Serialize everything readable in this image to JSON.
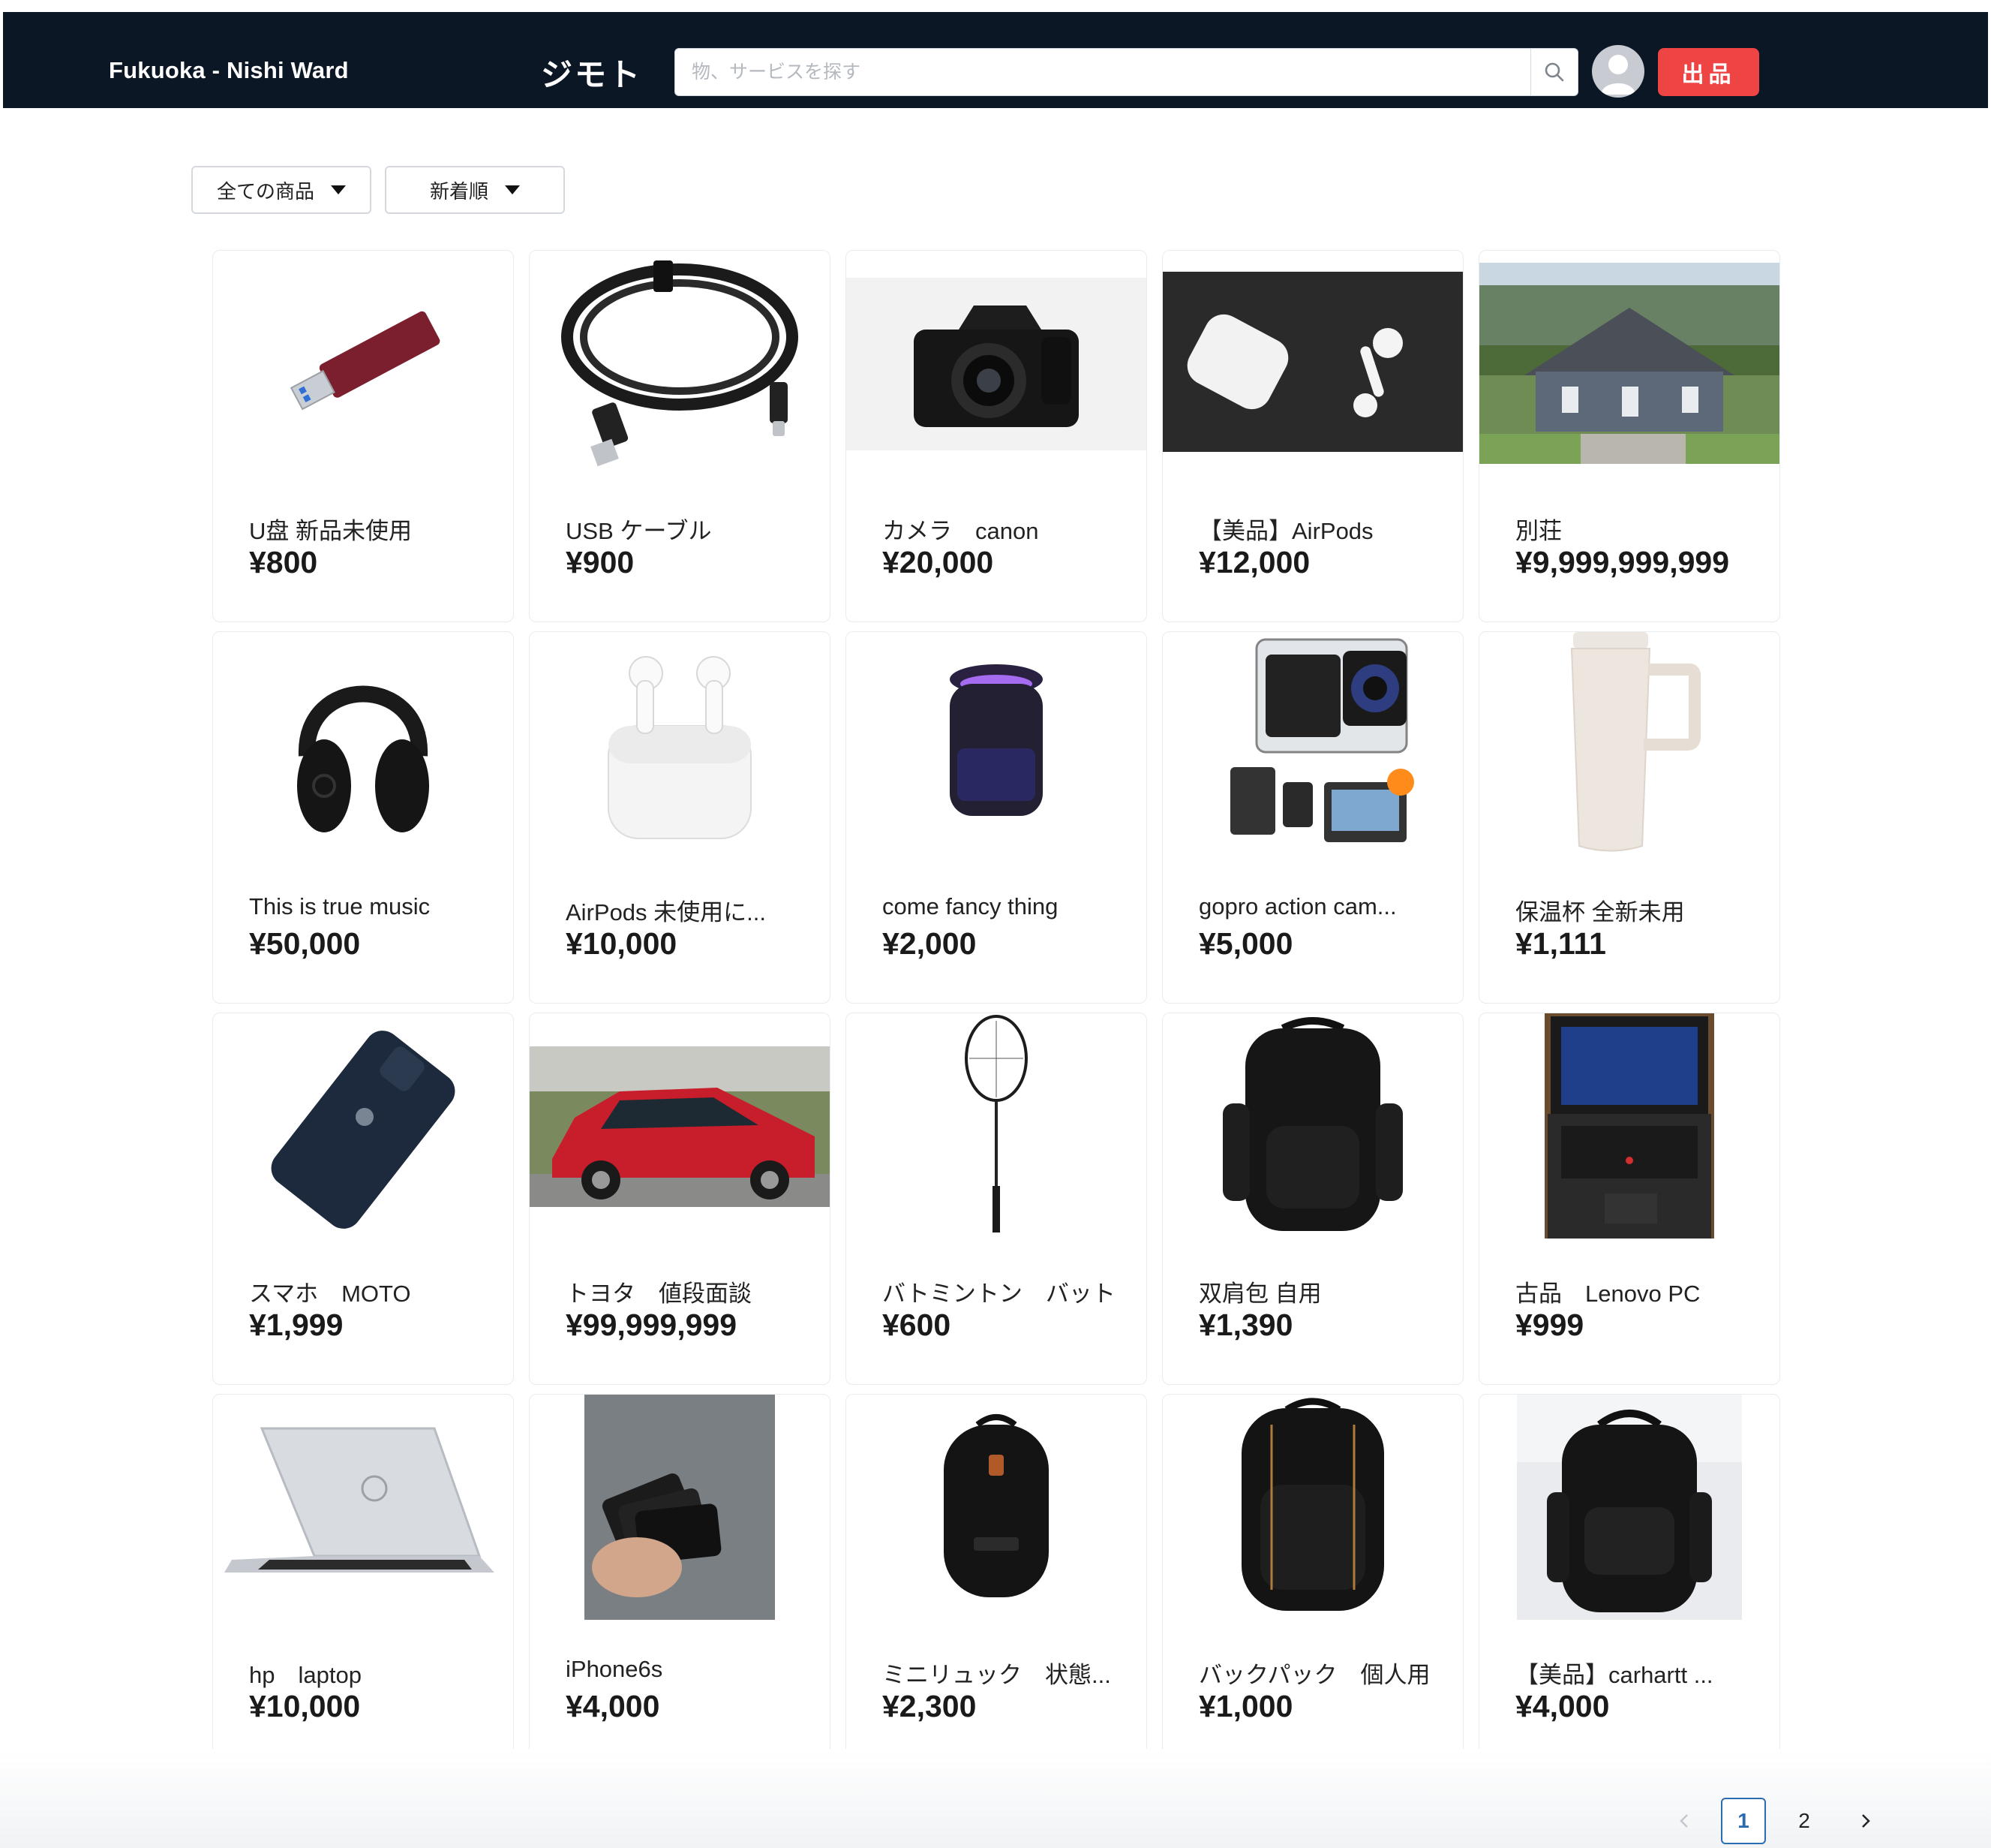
{
  "header": {
    "location": "Fukuoka - Nishi Ward",
    "brand": "ジモト",
    "search_placeholder": "物、サービスを探す",
    "post_label": "出品"
  },
  "filters": {
    "category": "全ての商品",
    "sort": "新着順"
  },
  "products": [
    {
      "title": "U盘 新品未使用",
      "price": "¥800",
      "icon": "usb-drive-icon"
    },
    {
      "title": "USB ケーブル",
      "price": "¥900",
      "icon": "usb-cable-icon"
    },
    {
      "title": "カメラ　canon",
      "price": "¥20,000",
      "icon": "camera-icon"
    },
    {
      "title": "【美品】AirPods",
      "price": "¥12,000",
      "icon": "earbuds-icon"
    },
    {
      "title": "別荘",
      "price": "¥9,999,999,999",
      "icon": "house-icon"
    },
    {
      "title": "This is true music",
      "price": "¥50,000",
      "icon": "headphones-icon"
    },
    {
      "title": "AirPods 未使用に...",
      "price": "¥10,000",
      "icon": "airpods-case-icon"
    },
    {
      "title": "come fancy thing",
      "price": "¥2,000",
      "icon": "bug-lamp-icon"
    },
    {
      "title": "gopro action cam...",
      "price": "¥5,000",
      "icon": "action-camera-icon"
    },
    {
      "title": "保温杯 全新未用",
      "price": "¥1,111",
      "icon": "tumbler-icon"
    },
    {
      "title": "スマホ　MOTO",
      "price": "¥1,999",
      "icon": "smartphone-icon"
    },
    {
      "title": "トヨタ　値段面談",
      "price": "¥99,999,999",
      "icon": "car-icon"
    },
    {
      "title": "バトミントン　バット",
      "price": "¥600",
      "icon": "racket-icon"
    },
    {
      "title": "双肩包 自用",
      "price": "¥1,390",
      "icon": "backpack-icon"
    },
    {
      "title": "古品　Lenovo PC",
      "price": "¥999",
      "icon": "laptop-icon"
    },
    {
      "title": "hp　laptop",
      "price": "¥10,000",
      "icon": "laptop-icon"
    },
    {
      "title": "iPhone6s",
      "price": "¥4,000",
      "icon": "phones-icon"
    },
    {
      "title": "ミニリュック　状態...",
      "price": "¥2,300",
      "icon": "backpack-icon"
    },
    {
      "title": "バックパック　個人用",
      "price": "¥1,000",
      "icon": "backpack-icon"
    },
    {
      "title": "【美品】carhartt ...",
      "price": "¥4,000",
      "icon": "backpack-icon"
    }
  ],
  "pagination": {
    "pages": [
      "1",
      "2"
    ],
    "current": "1",
    "prev_icon": "chevron-left-icon",
    "next_icon": "chevron-right-icon"
  },
  "colors": {
    "header_bg": "#0c1726",
    "accent": "#ef4444",
    "pager_active": "#2b6cb0"
  }
}
